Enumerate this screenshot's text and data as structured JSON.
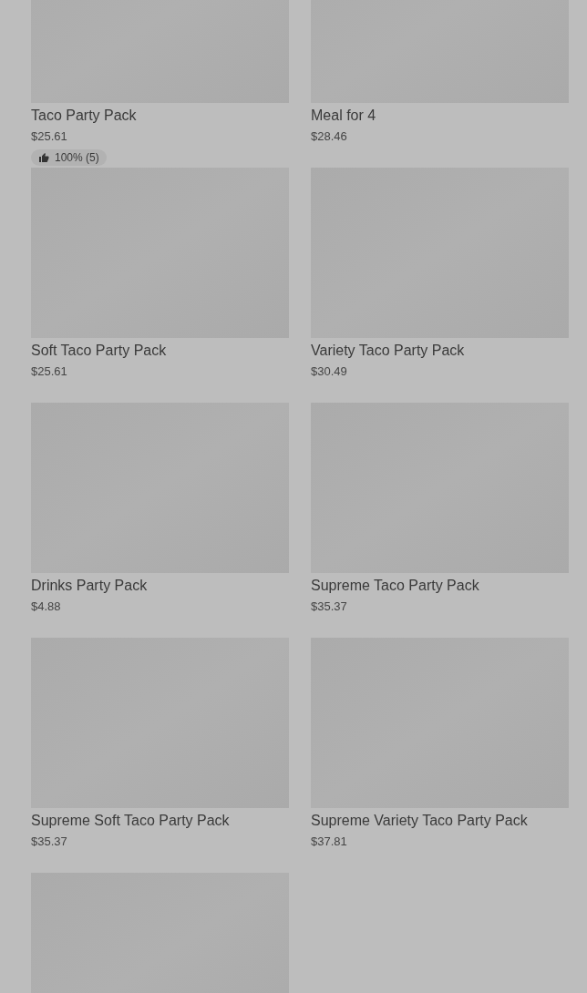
{
  "products": [
    {
      "kind": "product",
      "name": "Taco Party Pack",
      "price": "$25.61",
      "rating": "100% (5)"
    },
    {
      "kind": "product",
      "name": "Meal for 4",
      "price": "$28.46"
    },
    {
      "kind": "product",
      "name": "Soft Taco Party Pack",
      "price": "$25.61"
    },
    {
      "kind": "product",
      "name": "Variety Taco Party Pack",
      "price": "$30.49"
    },
    {
      "kind": "product",
      "name": "Drinks Party Pack",
      "price": "$4.88"
    },
    {
      "kind": "product",
      "name": "Supreme Taco Party Pack",
      "price": "$35.37"
    },
    {
      "kind": "product",
      "name": "Supreme Soft Taco Party Pack",
      "price": "$35.37"
    },
    {
      "kind": "product",
      "name": "Supreme Variety Taco Party Pack",
      "price": "$37.81"
    },
    {
      "kind": "image_only"
    }
  ]
}
